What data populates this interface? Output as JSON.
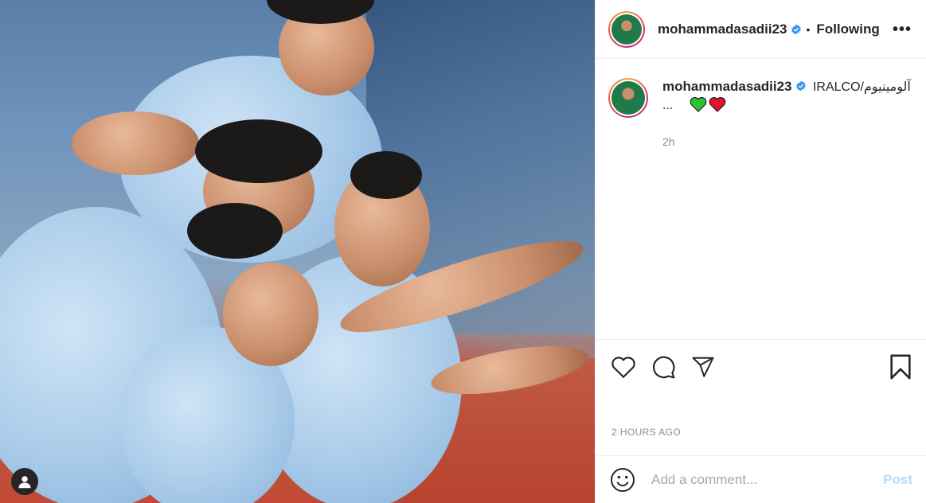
{
  "post": {
    "photo_alt": "Iran national team players celebrating",
    "user_tag_icon": "person-icon"
  },
  "header": {
    "username": "mohammadasadii23",
    "separator": "•",
    "follow_status": "Following",
    "more_label": "•••"
  },
  "caption": {
    "username": "mohammadasadii23",
    "text": "IRALCO/آلومینیوم",
    "more": "...",
    "emojis": [
      "green-heart-icon",
      "red-heart-icon"
    ],
    "time": "2h"
  },
  "actions": {
    "like_icon": "heart-icon",
    "comment_icon": "comment-icon",
    "share_icon": "paper-plane-icon",
    "save_icon": "bookmark-icon"
  },
  "posted_time": "2 HOURS AGO",
  "comment": {
    "emoji_icon": "smiley-icon",
    "placeholder": "Add a comment...",
    "post_label": "Post"
  },
  "colors": {
    "verified": "#3897f0",
    "post_button_disabled": "#b3dbff",
    "green_heart": "#2fc12f",
    "red_heart": "#e0142c"
  }
}
